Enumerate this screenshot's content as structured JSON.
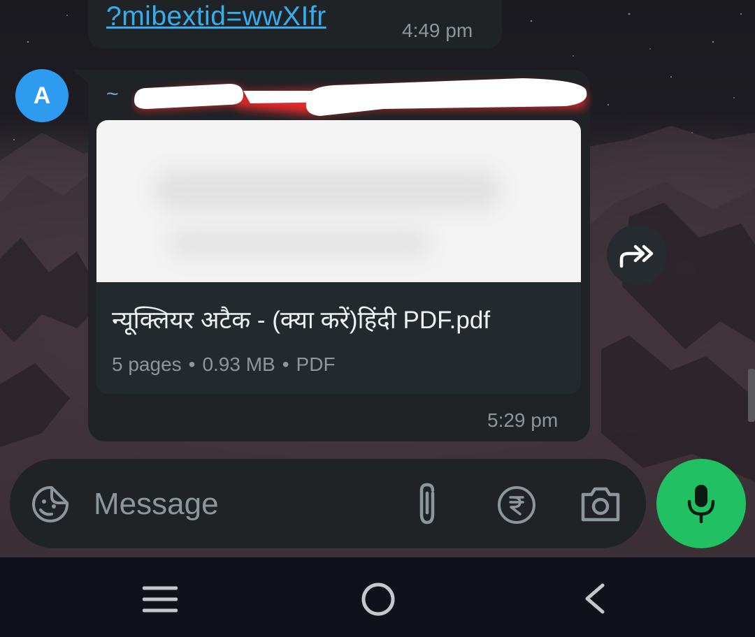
{
  "chat": {
    "previous_message": {
      "link_text": "?mibextid=wwXIfr",
      "time": "4:49 pm"
    },
    "document_message": {
      "avatar_letter": "A",
      "sender_prefix": "~",
      "file_name": "न्यूक्लियर अटैक - (क्या करें)हिंदी PDF.pdf",
      "pages": "5 pages",
      "size": "0.93 MB",
      "type": "PDF",
      "separator": "•",
      "time": "5:29 pm"
    }
  },
  "composer": {
    "placeholder": "Message",
    "icons": [
      "emoji-sticker-icon",
      "paperclip-icon",
      "rupee-icon",
      "camera-icon",
      "microphone-icon"
    ]
  },
  "navbar": {
    "icons": [
      "recents-icon",
      "home-icon",
      "back-icon"
    ]
  },
  "colors": {
    "bubble": "#1f2326",
    "link": "#35aef0",
    "avatar": "#2d9cf0",
    "mic_button": "#21c063",
    "navbar": "#0f121b",
    "meta_text": "#8d969b"
  }
}
